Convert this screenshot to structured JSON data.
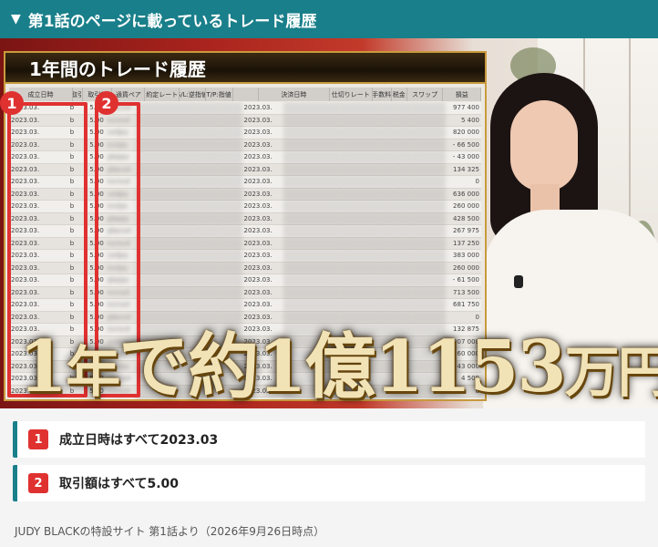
{
  "header": {
    "title": "第1話のページに載っているトレード履歴"
  },
  "table": {
    "title": "1年間のトレード履歴",
    "columns": [
      "成立日時",
      "取引",
      "取引額",
      "通貨ペア",
      "約定レート",
      "S/L:逆指値",
      "T/P:指値",
      "",
      "決済日時",
      "仕切りレート",
      "手数料",
      "税金",
      "スワップ",
      "損益"
    ],
    "rows": [
      {
        "date": "2023.03.",
        "kind": "b",
        "amount": "5.00",
        "pair": "gbpusd",
        "settle": "2023.03.",
        "pl": "977 400"
      },
      {
        "date": "2023.03.",
        "kind": "b",
        "amount": "5.00",
        "pair": "euraud",
        "settle": "2023.03.",
        "pl": "5 400"
      },
      {
        "date": "2023.03.",
        "kind": "b",
        "amount": "5.00",
        "pair": "usdjpy",
        "settle": "2023.03.",
        "pl": "820 000"
      },
      {
        "date": "2023.03.",
        "kind": "b",
        "amount": "5.00",
        "pair": "eurjpy",
        "settle": "2023.03.",
        "pl": "- 66 500"
      },
      {
        "date": "2023.03.",
        "kind": "b",
        "amount": "5.00",
        "pair": "gbpjpy",
        "settle": "2023.03.",
        "pl": "- 43 000"
      },
      {
        "date": "2023.03.",
        "kind": "b",
        "amount": "5.00",
        "pair": "gbpusd",
        "settle": "2023.03.",
        "pl": "134 325"
      },
      {
        "date": "2023.03.",
        "kind": "b",
        "amount": "5.00",
        "pair": "euraud",
        "settle": "2023.03.",
        "pl": "0"
      },
      {
        "date": "2023.03.",
        "kind": "b",
        "amount": "5.00",
        "pair": "usdjpy",
        "settle": "2023.03.",
        "pl": "636 000"
      },
      {
        "date": "2023.03.",
        "kind": "b",
        "amount": "5.00",
        "pair": "eurjpy",
        "settle": "2023.03.",
        "pl": "260 000"
      },
      {
        "date": "2023.03.",
        "kind": "b",
        "amount": "5.00",
        "pair": "gbpjpy",
        "settle": "2023.03.",
        "pl": "428 500"
      },
      {
        "date": "2023.03.",
        "kind": "b",
        "amount": "5.00",
        "pair": "gbpusd",
        "settle": "2023.03.",
        "pl": "267 975"
      },
      {
        "date": "2023.03.",
        "kind": "b",
        "amount": "5.00",
        "pair": "euraud",
        "settle": "2023.03.",
        "pl": "137 250"
      },
      {
        "date": "2023.03.",
        "kind": "b",
        "amount": "5.00",
        "pair": "usdjpy",
        "settle": "2023.03.",
        "pl": "383 000"
      },
      {
        "date": "2023.03.",
        "kind": "b",
        "amount": "5.00",
        "pair": "eurjpy",
        "settle": "2023.03.",
        "pl": "260 000"
      },
      {
        "date": "2023.03.",
        "kind": "b",
        "amount": "5.00",
        "pair": "gbpjpy",
        "settle": "2023.03.",
        "pl": "- 61 500"
      },
      {
        "date": "2023.03.",
        "kind": "b",
        "amount": "5.00",
        "pair": "eurusd",
        "settle": "2023.03.",
        "pl": "713 500"
      },
      {
        "date": "2023.03.",
        "kind": "b",
        "amount": "5.00",
        "pair": "eurusd",
        "settle": "2023.03.",
        "pl": "681 750"
      },
      {
        "date": "2023.03.",
        "kind": "b",
        "amount": "5.00",
        "pair": "gbpusd",
        "settle": "2023.03.",
        "pl": "0"
      },
      {
        "date": "2023.03.",
        "kind": "b",
        "amount": "5.00",
        "pair": "euraud",
        "settle": "2023.03.",
        "pl": "132 875"
      },
      {
        "date": "2023.03.",
        "kind": "b",
        "amount": "5.00",
        "pair": "usdjpy",
        "settle": "2023.03.",
        "pl": "1 007 000"
      },
      {
        "date": "2023.03.",
        "kind": "b",
        "amount": "5.00",
        "pair": "eurjpy",
        "settle": "2023.03.",
        "pl": "260 000"
      },
      {
        "date": "2023.03.",
        "kind": "b",
        "amount": "5.00",
        "pair": "gbpjpy",
        "settle": "2023.03.",
        "pl": "- 43 000"
      },
      {
        "date": "2023.03.",
        "kind": "b",
        "amount": "5.00",
        "pair": "gbpusd",
        "settle": "2023.03.",
        "pl": "4 500"
      },
      {
        "date": "2023.03.",
        "kind": "b",
        "amount": "5.00",
        "pair": "euraud",
        "settle": "2023.03.",
        "pl": "0"
      },
      {
        "date": "2023.03.",
        "kind": "b",
        "amount": "5.00",
        "pair": "usdjpy",
        "settle": "2023.03.",
        "pl": "538 700"
      }
    ]
  },
  "badges": [
    "1",
    "2"
  ],
  "caption": {
    "prefix": "1",
    "year": "年",
    "mid": "で約1億1153",
    "suffix": "万円"
  },
  "notes": [
    {
      "num": "1",
      "text": "成立日時はすべて2023.03"
    },
    {
      "num": "2",
      "text": "取引額はすべて5.00"
    }
  ],
  "footer": {
    "text": "JUDY BLACKの特設サイト 第1話より（2026年9月26日時点）"
  },
  "colors": {
    "accent": "#197f8a",
    "highlight": "#e03131",
    "gold": "#c99a3d"
  }
}
